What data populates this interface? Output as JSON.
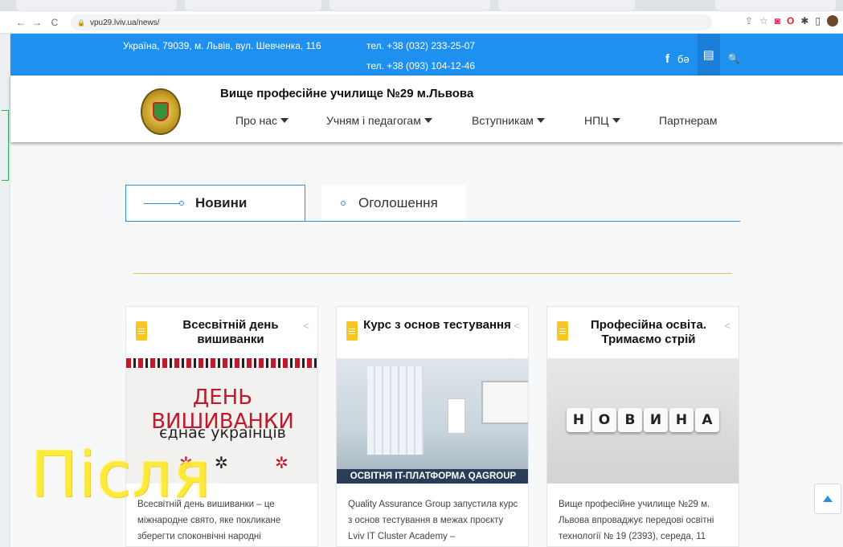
{
  "browser": {
    "url": "vpu29.lviv.ua/news/",
    "nav_back": "←",
    "nav_forward": "→",
    "nav_reload": "C",
    "lock": "🔒",
    "ext_icons": [
      "share-icon",
      "star-icon",
      "pocket-icon",
      "opera-icon",
      "puzzle-icon",
      "sidepanel-icon",
      "profile-avatar"
    ]
  },
  "topbar": {
    "address": "Україна, 79039, м. Львів, вул. Шевченка, 116",
    "phone1": "тел. +38 (032) 233-25-07",
    "phone2": "тел. +38 (093) 104-12-46",
    "facebook": "f",
    "vk": "бə",
    "chat": "▤",
    "search": "🔍",
    "color": "#1e90f0"
  },
  "header": {
    "school_name": "Вище професійне училище №29 м.Львова",
    "menu": [
      {
        "label": "Про нас",
        "dropdown": true
      },
      {
        "label": "Учням і педагогам",
        "dropdown": true
      },
      {
        "label": "Вступникам",
        "dropdown": true
      },
      {
        "label": "НПЦ",
        "dropdown": true
      },
      {
        "label": "Партнерам",
        "dropdown": false
      }
    ]
  },
  "tabs": {
    "active": "Новини",
    "inactive": "Оголошення"
  },
  "cards": [
    {
      "title": "Всесвітній день вишиванки",
      "image_big": "ДЕНЬ ВИШИВАНКИ",
      "image_small": "єднає українців",
      "excerpt": "Всесвітній день вишиванки – це міжнародне свято, яке покликане зберегти споконвічні народні"
    },
    {
      "title": "Курс з основ тестування",
      "image_banner": "ОСВІТНЯ IT-ПЛАТФОРМА QAGROUP",
      "excerpt": "Quality Assurance Group запустила курс з основ тестування в межах проєкту Lviv IT Cluster Academy –"
    },
    {
      "title": "Професійна освіта. Тримаємо стрій",
      "image_letters": [
        "Н",
        "О",
        "В",
        "И",
        "Н",
        "А"
      ],
      "excerpt": "Вище професійне училище №29 м. Львова впроваджує передові освітні технології № 19 (2393), середа, 11"
    }
  ],
  "overlay": {
    "word": "Після",
    "color": "#ffe927"
  },
  "scroll_top": "▲"
}
